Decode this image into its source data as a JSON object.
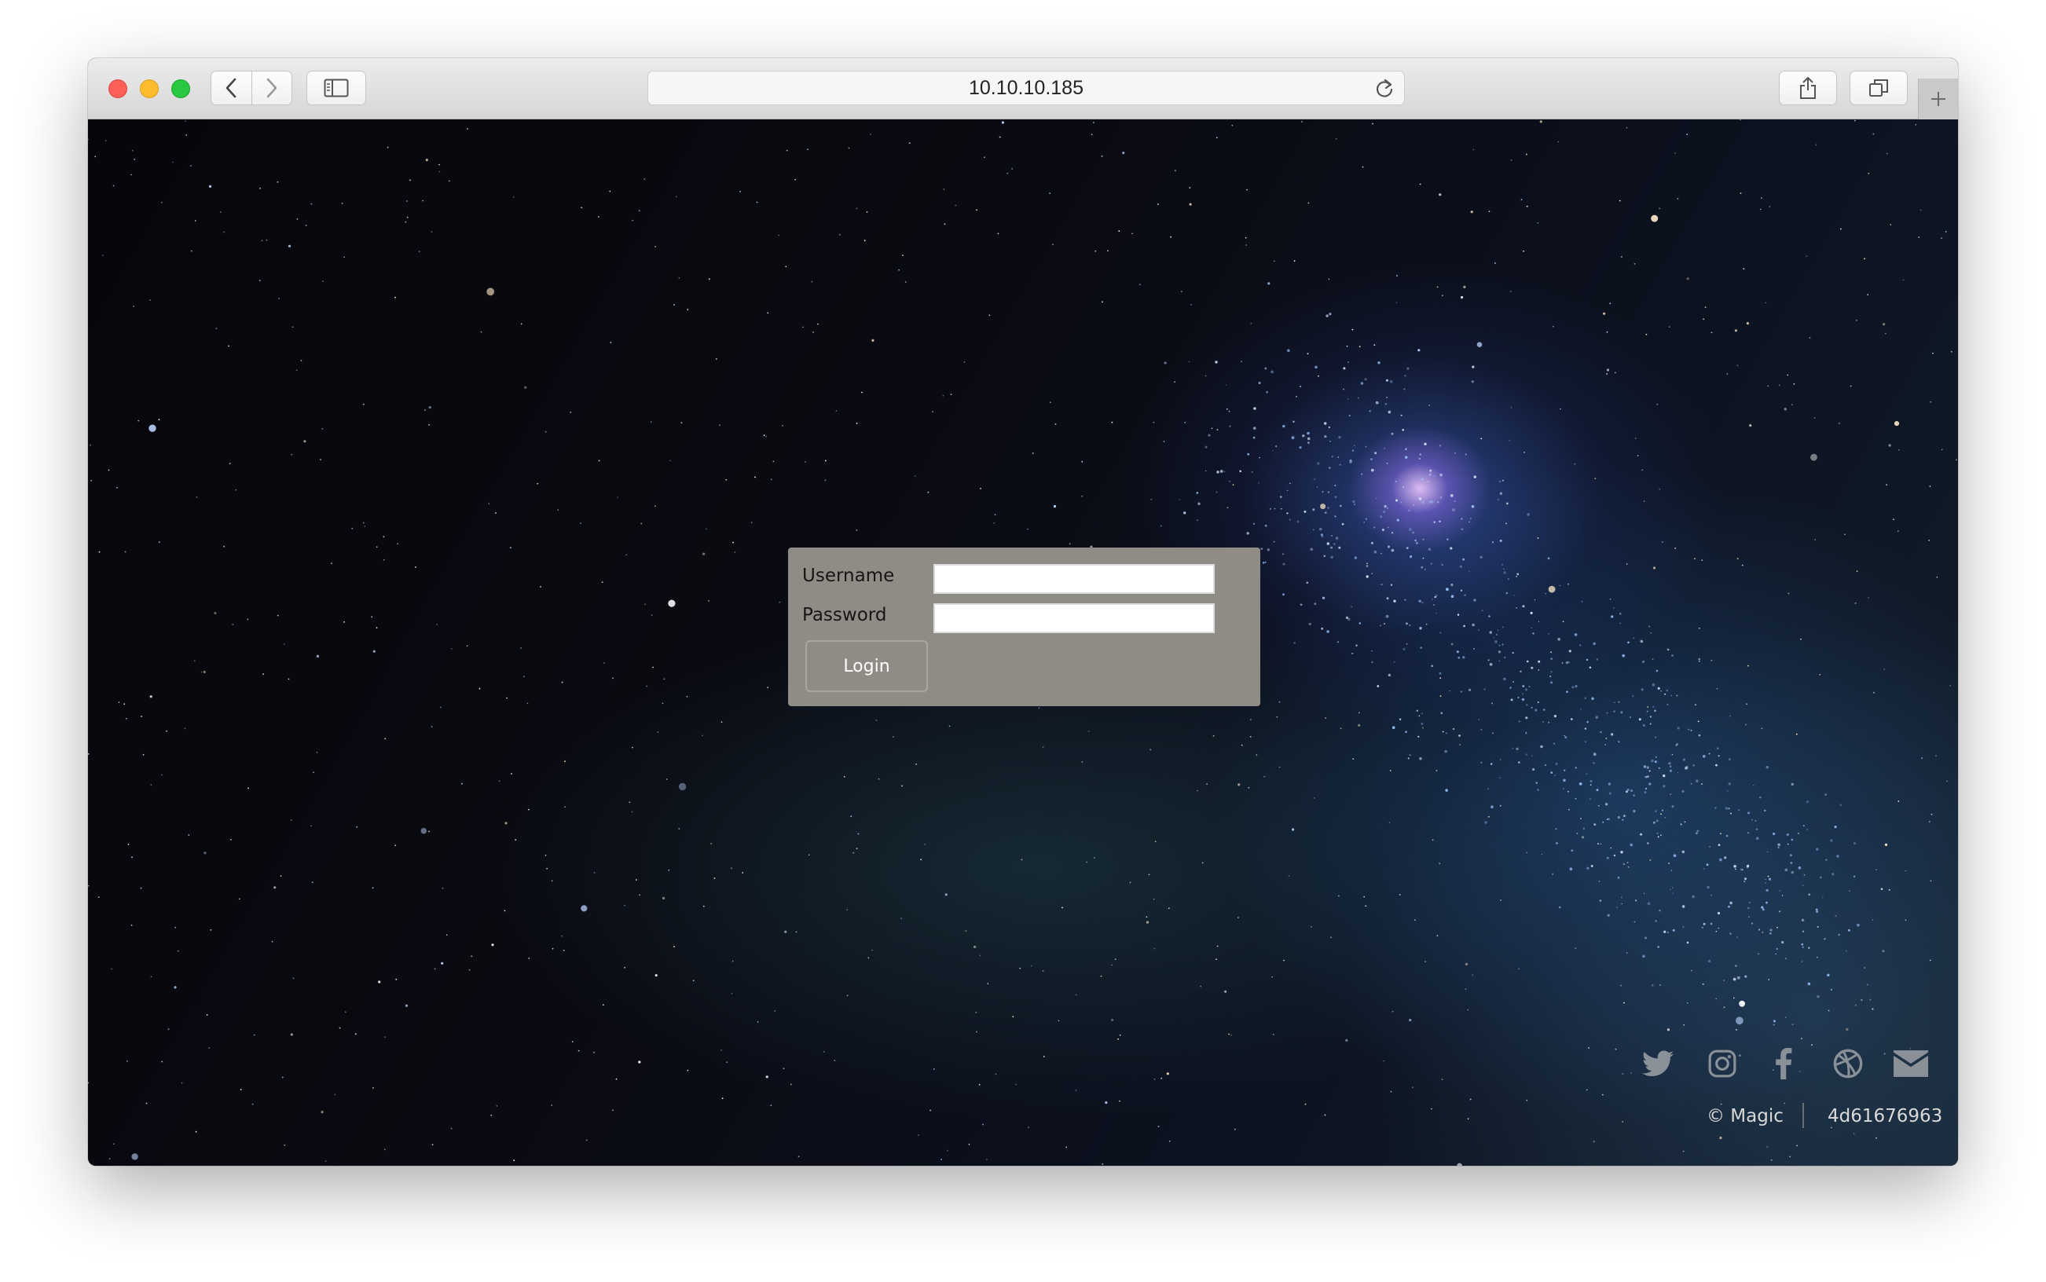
{
  "browser": {
    "url": "10.10.10.185",
    "traffic_lights": [
      "close",
      "minimize",
      "zoom"
    ],
    "icons": {
      "back": "chevron-left-icon",
      "forward": "chevron-right-icon",
      "sidebar": "sidebar-icon",
      "reload": "reload-icon",
      "share": "share-icon",
      "tabs": "tabs-overview-icon",
      "new_tab": "plus-icon"
    }
  },
  "login_form": {
    "username_label": "Username",
    "username_value": "",
    "password_label": "Password",
    "password_value": "",
    "submit_label": "Login"
  },
  "footer": {
    "copyright": "© Magic",
    "code": "4d61676963",
    "social_icons": [
      "twitter-icon",
      "instagram-icon",
      "facebook-icon",
      "dribbble-icon",
      "email-icon"
    ]
  },
  "colors": {
    "login_panel": "#8f8c85",
    "footer_text": "#d9d9d9",
    "social_icon": "#8a9098",
    "close": "#fc5f57",
    "minimize": "#fdbc2e",
    "zoom": "#28c840"
  }
}
